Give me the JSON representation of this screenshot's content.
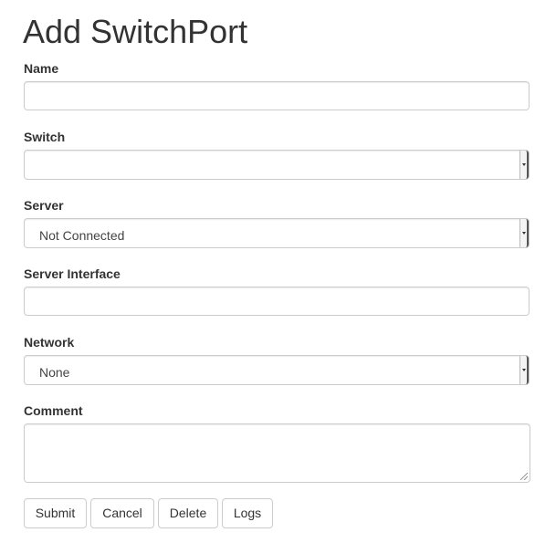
{
  "page": {
    "title": "Add SwitchPort"
  },
  "form": {
    "name": {
      "label": "Name",
      "value": ""
    },
    "switch": {
      "label": "Switch",
      "selected": ""
    },
    "server": {
      "label": "Server",
      "selected": "Not Connected"
    },
    "server_interface": {
      "label": "Server Interface",
      "value": ""
    },
    "network": {
      "label": "Network",
      "selected": "None"
    },
    "comment": {
      "label": "Comment",
      "value": ""
    }
  },
  "actions": {
    "submit": "Submit",
    "cancel": "Cancel",
    "delete": "Delete",
    "logs": "Logs"
  },
  "colors": {
    "text": "#333333",
    "border": "#cccccc",
    "background": "#ffffff"
  }
}
